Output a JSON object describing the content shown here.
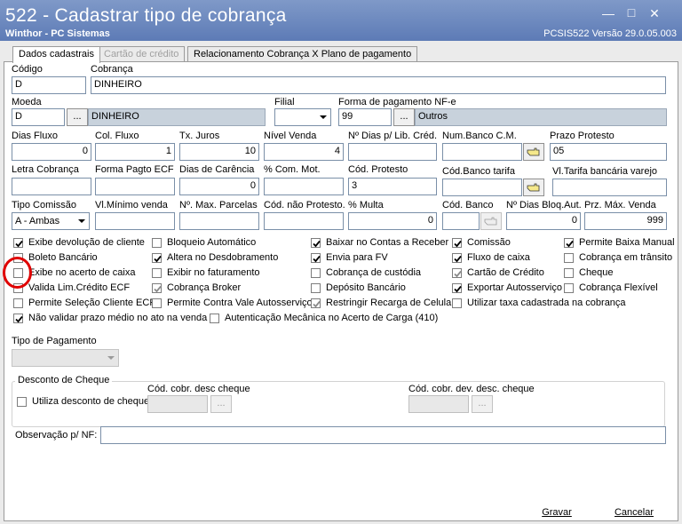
{
  "window": {
    "title": "522 - Cadastrar tipo de cobrança",
    "subtitle": "Winthor - PC Sistemas",
    "version": "PCSIS522  Versão  29.0.05.003"
  },
  "tabs": [
    "Dados cadastrais",
    "Cartão de crédito",
    "Relacionamento Cobrança X Plano de pagamento"
  ],
  "labels": {
    "codigo": "Código",
    "cobranca": "Cobrança",
    "moeda": "Moeda",
    "filial": "Filial",
    "forma_nfe": "Forma de pagamento NF-e",
    "dias_fluxo": "Dias Fluxo",
    "col_fluxo": "Col. Fluxo",
    "tx_juros": "Tx. Juros",
    "nivel_venda": "Nível Venda",
    "dias_lib": "Nº Dias p/ Lib. Créd.",
    "num_banco": "Num.Banco C.M.",
    "prazo_protesto": "Prazo Protesto",
    "letra": "Letra Cobrança",
    "forma_ecf": "Forma Pagto ECF",
    "carencia": "Dias de Carência",
    "com_mot": "% Com. Mot.",
    "cod_protesto": "Cód. Protesto",
    "cod_banco_tarifa": "Cód.Banco tarifa",
    "vl_tarifa": "Vl.Tarifa bancária varejo",
    "tipo_comissao": "Tipo Comissão",
    "vl_min": "Vl.Mínimo venda",
    "max_parc": "Nº. Max. Parcelas",
    "cod_nao_prot": "Cód. não Protesto.",
    "multa": "% Multa",
    "cod_banco": "Cód. Banco",
    "dias_bloq": "Nº Dias Bloq.Aut.",
    "prz_max": "Prz. Máx. Venda",
    "tipo_pagamento": "Tipo de Pagamento",
    "desconto_cheque": "Desconto de Cheque",
    "cod_desc_cheque": "Cód. cobr. desc cheque",
    "cod_dev_cheque": "Cód. cobr. dev. desc. cheque",
    "observacao": "Observação p/ NF:"
  },
  "values": {
    "codigo": "D",
    "cobranca": "DINHEIRO",
    "moeda": "D",
    "moeda_desc": "DINHEIRO",
    "forma_nfe": "99",
    "forma_nfe_desc": "Outros",
    "dias_fluxo": "0",
    "col_fluxo": "1",
    "tx_juros": "10",
    "nivel_venda": "4",
    "prazo_protesto": "05",
    "carencia": "0",
    "cod_protesto": "3",
    "tipo_comissao": "A - Ambas",
    "multa": "0",
    "dias_bloq": "0",
    "prz_max": "999"
  },
  "buttons": {
    "ellipsis": "...",
    "gravar": "Gravar",
    "cancelar": "Cancelar"
  },
  "checkboxes": {
    "exibe_devolucao": {
      "label": "Exibe devolução de cliente",
      "checked": true
    },
    "boleto": {
      "label": "Boleto Bancário",
      "checked": false
    },
    "exibe_acerto": {
      "label": "Exibe no acerto de caixa",
      "checked": false
    },
    "valida_lim": {
      "label": "Valida Lim.Crédito ECF",
      "checked": false
    },
    "permite_selecao": {
      "label": "Permite Seleção Cliente ECF",
      "checked": false
    },
    "nao_validar": {
      "label": "Não validar prazo médio no ato na venda",
      "checked": true
    },
    "bloqueio": {
      "label": "Bloqueio Automático",
      "checked": false
    },
    "altera_desdob": {
      "label": "Altera no Desdobramento",
      "checked": true
    },
    "exibir_fat": {
      "label": "Exibir no faturamento",
      "checked": false
    },
    "cob_broker": {
      "label": "Cobrança Broker",
      "checked": true
    },
    "contra_vale": {
      "label": "Permite Contra Vale Autosserviço",
      "checked": false
    },
    "autenticacao": {
      "label": "Autenticação Mecânica no Acerto de Carga (410)",
      "checked": false
    },
    "baixar_contas": {
      "label": "Baixar no Contas a Receber",
      "checked": true
    },
    "envia_fv": {
      "label": "Envia para FV",
      "checked": true
    },
    "cob_custodia": {
      "label": "Cobrança de custódia",
      "checked": false
    },
    "deposito": {
      "label": "Depósito Bancário",
      "checked": false
    },
    "restringir": {
      "label": "Restringir Recarga de Celular",
      "checked": true
    },
    "comissao": {
      "label": "Comissão",
      "checked": true
    },
    "fluxo_caixa": {
      "label": "Fluxo de caixa",
      "checked": true
    },
    "cartao_credito": {
      "label": "Cartão de Crédito",
      "checked": true
    },
    "exportar_auto": {
      "label": "Exportar Autosserviço",
      "checked": true
    },
    "utilizar_taxa": {
      "label": "Utilizar taxa cadastrada na cobrança",
      "checked": false
    },
    "permite_baixa": {
      "label": "Permite Baixa Manual",
      "checked": true
    },
    "cob_transito": {
      "label": "Cobrança em trânsito",
      "checked": false
    },
    "cheque": {
      "label": "Cheque",
      "checked": false
    },
    "cob_flexivel": {
      "label": "Cobrança Flexível",
      "checked": false
    },
    "utiliza_desconto": {
      "label": "Utiliza desconto de cheque",
      "checked": false
    }
  },
  "colors": {
    "titlebar": "#6a86bd",
    "readonly_field": "#c8d2dc",
    "highlight": "#e00000"
  }
}
